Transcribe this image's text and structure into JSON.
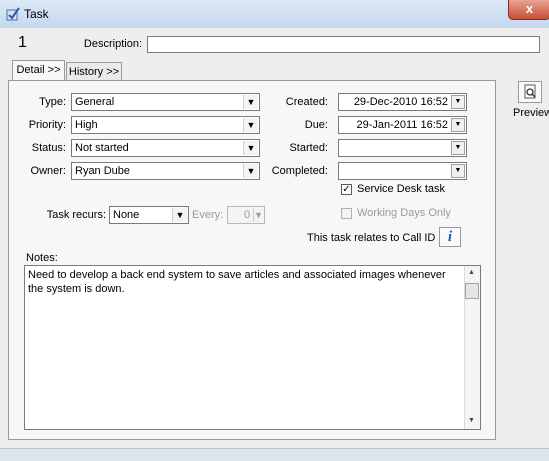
{
  "window": {
    "title": "Task",
    "close_label": "x"
  },
  "header": {
    "task_number": "1",
    "description_label": "Description:",
    "description_value": ""
  },
  "tabs": [
    {
      "label": "Detail >>"
    },
    {
      "label": "History >>"
    }
  ],
  "preview": {
    "label": "Preview",
    "icon": "preview-icon"
  },
  "fields": {
    "type": {
      "label": "Type:",
      "value": "General"
    },
    "priority": {
      "label": "Priority:",
      "value": "High"
    },
    "status": {
      "label": "Status:",
      "value": "Not started"
    },
    "owner": {
      "label": "Owner:",
      "value": "Ryan Dube"
    },
    "created": {
      "label": "Created:",
      "value": "29-Dec-2010 16:52"
    },
    "due": {
      "label": "Due:",
      "value": "29-Jan-2011 16:52"
    },
    "started": {
      "label": "Started:",
      "value": ""
    },
    "completed": {
      "label": "Completed:",
      "value": ""
    }
  },
  "service_desk": {
    "label": "Service Desk task",
    "checked": true
  },
  "working_days": {
    "label": "Working Days Only",
    "checked": false
  },
  "recurs": {
    "label": "Task recurs:",
    "value": "None",
    "every_label": "Every:",
    "every_value": "0"
  },
  "relates": {
    "text": "This task relates to Call ID 1"
  },
  "notes": {
    "label": "Notes:",
    "text": "Need to develop a back end system to save articles and associated images whenever the system is down."
  },
  "colors": {
    "info_icon": "#1f55c8",
    "titlebar": "#c5d8ee",
    "close": "#c74f35"
  }
}
